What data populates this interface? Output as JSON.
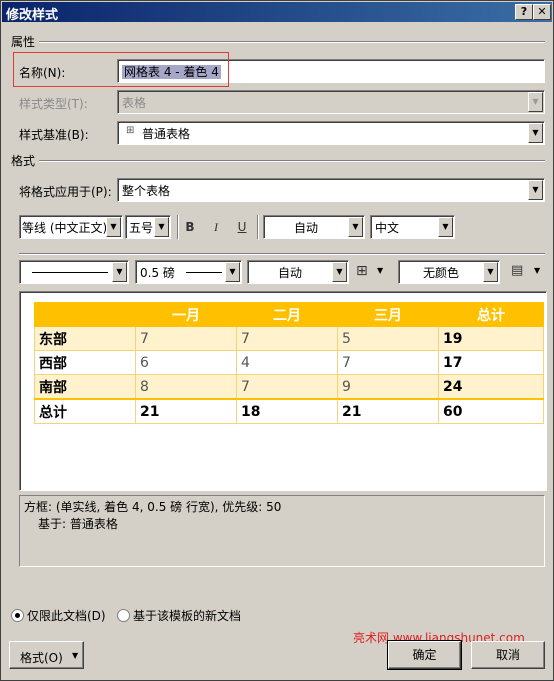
{
  "window": {
    "title": "修改样式",
    "help_label": "?",
    "close_label": "✕"
  },
  "properties": {
    "section_label": "属性",
    "name_label": "名称(N):",
    "name_value": "网格表 4 - 着色 4",
    "style_type_label": "样式类型(T):",
    "style_type_value": "表格",
    "based_on_label": "样式基准(B):",
    "based_on_icon": "table-grid-icon",
    "based_on_value": "普通表格"
  },
  "format": {
    "section_label": "格式",
    "apply_to_label": "将格式应用于(P):",
    "apply_to_value": "整个表格",
    "font_value": "等线 (中文正文)",
    "size_value": "五号",
    "bold_label": "B",
    "italic_label": "I",
    "underline_label": "U",
    "color_value": "自动",
    "lang_value": "中文",
    "border_weight_value": "0.5 磅",
    "border_color_value": "自动",
    "shading_value": "无颜色"
  },
  "preview_table": {
    "header": [
      "",
      "一月",
      "二月",
      "三月",
      "总计"
    ],
    "rows": [
      [
        "东部",
        "7",
        "7",
        "5",
        "19"
      ],
      [
        "西部",
        "6",
        "4",
        "7",
        "17"
      ],
      [
        "南部",
        "8",
        "7",
        "9",
        "24"
      ],
      [
        "总计",
        "21",
        "18",
        "21",
        "60"
      ]
    ],
    "accent_color": "#ffc000",
    "band_color": "#fff2cc"
  },
  "description": {
    "line1": "方框: (单实线, 着色 4,  0.5 磅 行宽), 优先级: 50",
    "line2": "基于: 普通表格"
  },
  "options": {
    "only_this_doc_label": "仅限此文档(D)",
    "only_this_doc_selected": true,
    "new_docs_label": "基于该模板的新文档",
    "new_docs_selected": false
  },
  "buttons": {
    "format_label": "格式(O)",
    "ok_label": "确定",
    "cancel_label": "取消"
  },
  "watermark": "亮术网 www.liangshunet.com"
}
